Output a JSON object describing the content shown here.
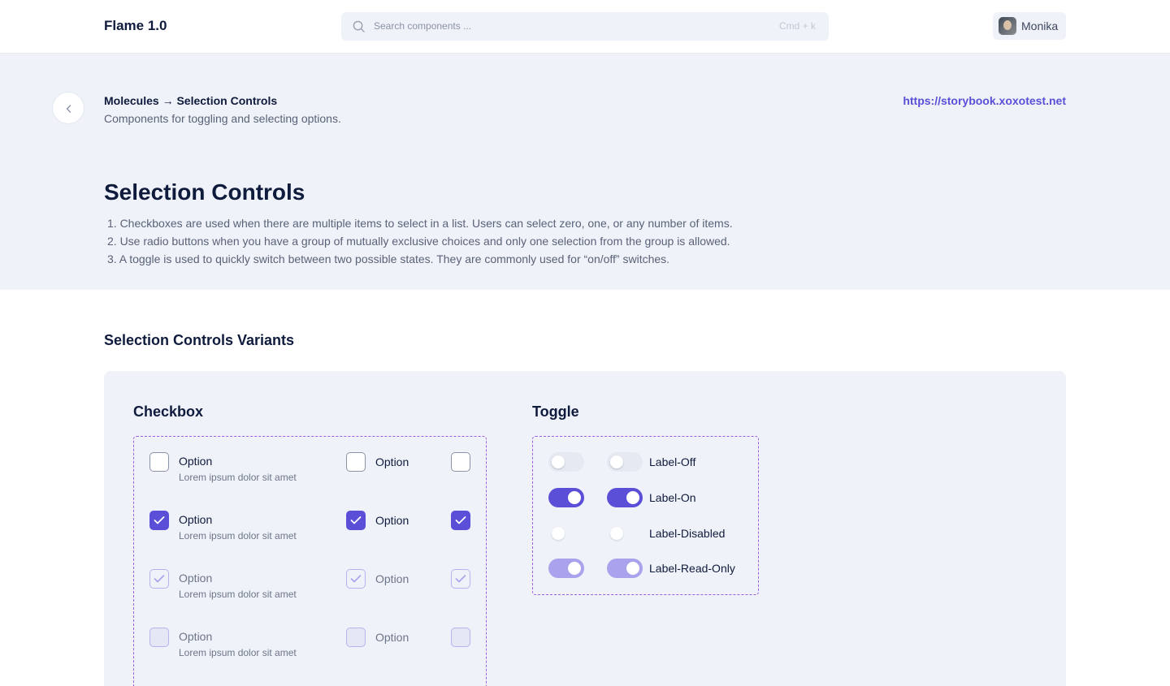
{
  "header": {
    "brand": "Flame 1.0",
    "search_placeholder": "Search components ...",
    "search_shortcut": "Cmd + k",
    "user_name": "Monika"
  },
  "hero": {
    "breadcrumb": "Molecules → Selection Controls",
    "subtitle": "Components for toggling and selecting options.",
    "link": "https://storybook.xoxotest.net",
    "title": "Selection Controls",
    "description": [
      "1. Checkboxes are used when there are multiple items to select in a list. Users can select zero, one, or any number of items.",
      "2. Use radio buttons when you have a group of mutually exclusive choices and only one selection from the group is allowed.",
      "3. A toggle is used to quickly switch between two possible states. They are commonly used for “on/off” switches."
    ]
  },
  "variants": {
    "title": "Selection Controls Variants",
    "checkbox": {
      "title": "Checkbox",
      "option_label": "Option",
      "option_hint": "Lorem ipsum dolor sit amet",
      "states": [
        "unchecked",
        "checked",
        "read-only",
        "disabled"
      ]
    },
    "toggle": {
      "title": "Toggle",
      "labels": [
        "Label-Off",
        "Label-On",
        "Label-Disabled",
        "Label-Read-Only"
      ]
    }
  },
  "colors": {
    "accent": "#5b4fd8",
    "accent_light": "#a9a2ec",
    "text_primary": "#0f1b3d",
    "text_secondary": "#5a6278",
    "surface": "#eff2f8",
    "dashed_border": "#9c5fe0"
  }
}
